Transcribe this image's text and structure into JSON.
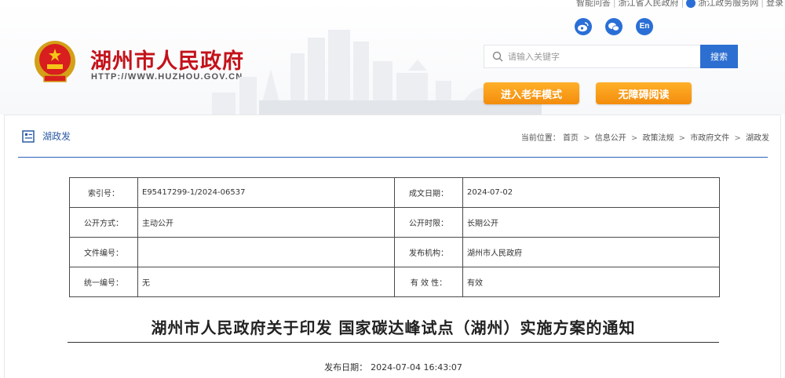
{
  "topbar": {
    "links": [
      "智能问答",
      "浙江省人民政府",
      "浙江政务服务网",
      "登录"
    ]
  },
  "social": [
    "weibo-icon",
    "wechat-icon",
    "En"
  ],
  "site": {
    "title": "湖州市人民政府",
    "url": "HTTP://WWW.HUZHOU.GOV.CN"
  },
  "search": {
    "placeholder": "请输入关键字",
    "button": "搜索"
  },
  "buttons": {
    "elder": "进入老年模式",
    "accessibility": "无障碍阅读"
  },
  "section": {
    "title": "湖政发"
  },
  "breadcrumb": {
    "prefix": "当前位置：",
    "items": [
      "首页",
      "信息公开",
      "政策法规",
      "市政府文件",
      "湖政发"
    ]
  },
  "info": {
    "rows": [
      [
        {
          "label": "索引号：",
          "value": "E95417299-1/2024-06537"
        },
        {
          "label": "成文日期：",
          "value": "2024-07-02"
        }
      ],
      [
        {
          "label": "公开方式：",
          "value": "主动公开"
        },
        {
          "label": "公开时限：",
          "value": "长期公开"
        }
      ],
      [
        {
          "label": "文件编号：",
          "value": ""
        },
        {
          "label": "发布机构：",
          "value": "湖州市人民政府"
        }
      ],
      [
        {
          "label": "统一编号：",
          "value": "无"
        },
        {
          "label": "有 效 性：",
          "value": "有效"
        }
      ]
    ]
  },
  "document": {
    "title": "湖州市人民政府关于印发 国家碳达峰试点（湖州）实施方案的通知",
    "date_label": "发布日期：",
    "date_value": "2024-07-04 16:43:07"
  },
  "colors": {
    "brand_red": "#c4121a",
    "accent_blue": "#2d6fd1",
    "orange": "#f59a14"
  }
}
